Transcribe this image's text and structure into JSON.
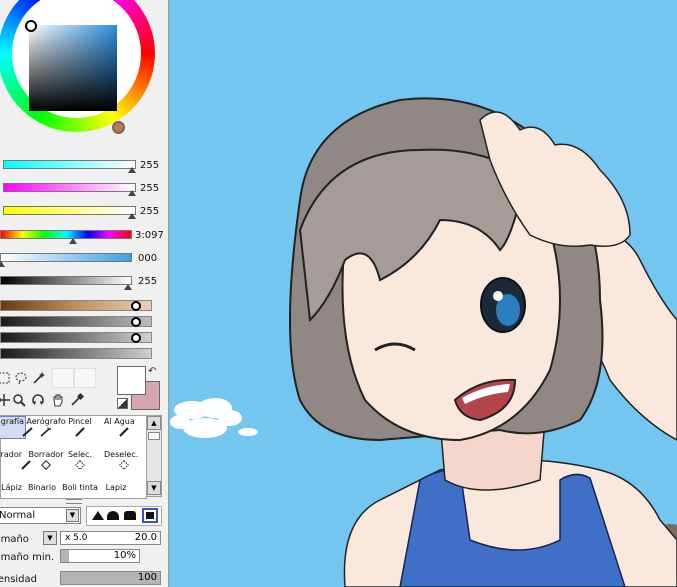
{
  "color": {
    "sliders": [
      {
        "id": "r",
        "value": "255"
      },
      {
        "id": "g",
        "value": "255"
      },
      {
        "id": "b",
        "value": "255"
      },
      {
        "id": "h",
        "value": "3:097"
      },
      {
        "id": "s",
        "value": "000"
      },
      {
        "id": "v",
        "value": "255"
      }
    ],
    "accent": "#d6a5b0"
  },
  "tools": {
    "row1": [
      "Caligrafía",
      "Aerógrafo",
      "Pincel",
      "Al Agua"
    ],
    "row2": [
      "Borrador",
      "Borrador",
      "Selec.",
      "Deselec."
    ],
    "row3": [
      "Lápiz",
      "Binario",
      "Boli tinta",
      "Lapiz"
    ]
  },
  "brush": {
    "mode": "Normal",
    "size_label": "Tamaño",
    "size_mult": "x 5.0",
    "size_value": "20.0",
    "min_size_label": "Tamaño min.",
    "min_size_value": "10%",
    "density_label": "Densidad",
    "density_value": "100"
  }
}
